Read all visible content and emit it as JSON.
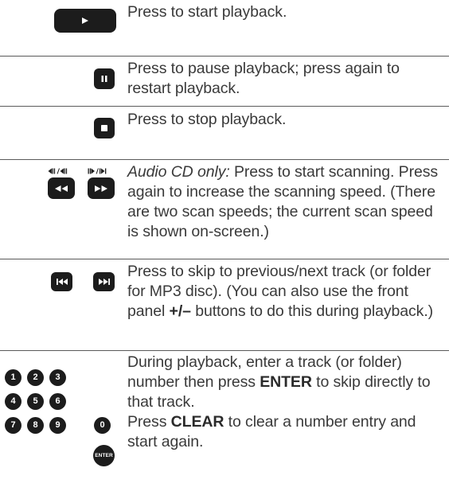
{
  "rows": [
    {
      "key": "play",
      "icon": "play-icon",
      "text": "Press to start  playback."
    },
    {
      "key": "pause",
      "icon": "pause-icon",
      "text": "Press to pause playback; press again to restart playback."
    },
    {
      "key": "stop",
      "icon": "stop-icon",
      "text": "Press to stop playback."
    },
    {
      "key": "scan",
      "icons": [
        "rewind-icon",
        "fast-forward-icon"
      ],
      "label_italic": "Audio CD only:",
      "text": " Press to start scanning. Press again to increase the scanning speed. (There are two scan speeds; the current scan speed is shown on-screen.)"
    },
    {
      "key": "skip",
      "icons": [
        "previous-track-icon",
        "next-track-icon"
      ],
      "text_before": "Press to skip to previous/next track (or folder for MP3 disc). (You can also use the front panel ",
      "text_bold": "+/–",
      "text_after": " buttons to do this during playback.)"
    },
    {
      "key": "number",
      "number_keys": [
        "1",
        "2",
        "3",
        "4",
        "5",
        "6",
        "7",
        "8",
        "9",
        "0"
      ],
      "enter_key": "ENTER",
      "p1_before": "During playback, enter a track (or folder) number then press ",
      "p1_bold": "ENTER",
      "p1_after": " to skip directly to that track.",
      "p2_before": "Press ",
      "p2_bold": "CLEAR",
      "p2_after": " to clear a number entry and start again."
    }
  ],
  "colors": {
    "button": "#1c1c1c",
    "text": "#3a3a3a",
    "rule": "#5a5a5a"
  }
}
